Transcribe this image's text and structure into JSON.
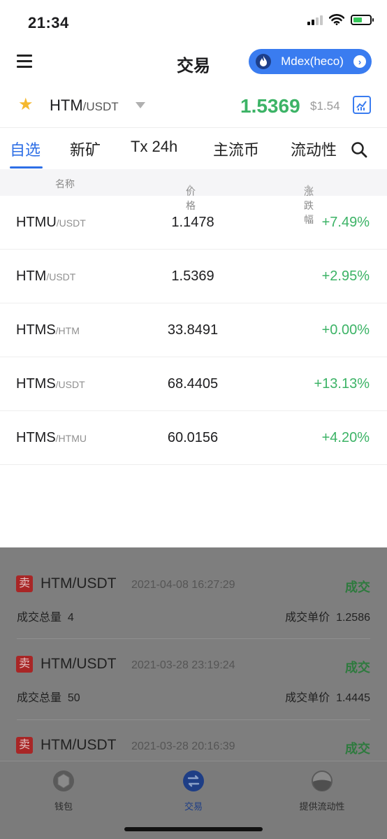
{
  "status_bar": {
    "time": "21:34"
  },
  "header": {
    "title": "交易",
    "dex_label": "Mdex(heco)"
  },
  "pair": {
    "base": "HTM",
    "quote": "/USDT",
    "price": "1.5369",
    "usd_price": "$1.54"
  },
  "tabs": [
    {
      "label": "自选",
      "active": true
    },
    {
      "label": "新矿",
      "active": false
    },
    {
      "label": "Tx 24h",
      "active": false
    },
    {
      "label": "主流币",
      "active": false
    },
    {
      "label": "流动性",
      "active": false
    }
  ],
  "table": {
    "headers": {
      "name": "名称",
      "price": "价格",
      "change": "涨跌幅"
    },
    "rows": [
      {
        "base": "HTMU",
        "quote": "/USDT",
        "price": "1.1478",
        "change": "+7.49%"
      },
      {
        "base": "HTM",
        "quote": "/USDT",
        "price": "1.5369",
        "change": "+2.95%"
      },
      {
        "base": "HTMS",
        "quote": "/HTM",
        "price": "33.8491",
        "change": "+0.00%"
      },
      {
        "base": "HTMS",
        "quote": "/USDT",
        "price": "68.4405",
        "change": "+13.13%"
      },
      {
        "base": "HTMS",
        "quote": "/HTMU",
        "price": "60.0156",
        "change": "+4.20%"
      }
    ]
  },
  "notifications": [
    {
      "badge": "卖",
      "pair": "HTM/USDT",
      "time": "2021-04-08 16:27:29",
      "status": "成交",
      "amount_label": "成交总量",
      "amount": "4",
      "unit_label": "成交单价",
      "unit": "1.2586"
    },
    {
      "badge": "卖",
      "pair": "HTM/USDT",
      "time": "2021-03-28 23:19:24",
      "status": "成交",
      "amount_label": "成交总量",
      "amount": "50",
      "unit_label": "成交单价",
      "unit": "1.4445"
    },
    {
      "badge": "卖",
      "pair": "HTM/USDT",
      "time": "2021-03-28 20:16:39",
      "status": "成交"
    }
  ],
  "bottom_nav": [
    {
      "label": "钱包"
    },
    {
      "label": "交易"
    },
    {
      "label": "提供流动性"
    }
  ],
  "colors": {
    "accent": "#2e6fe6",
    "pill": "#3a7cf0",
    "up": "#3cb366",
    "star": "#f5b82e",
    "sell": "#a82626"
  }
}
